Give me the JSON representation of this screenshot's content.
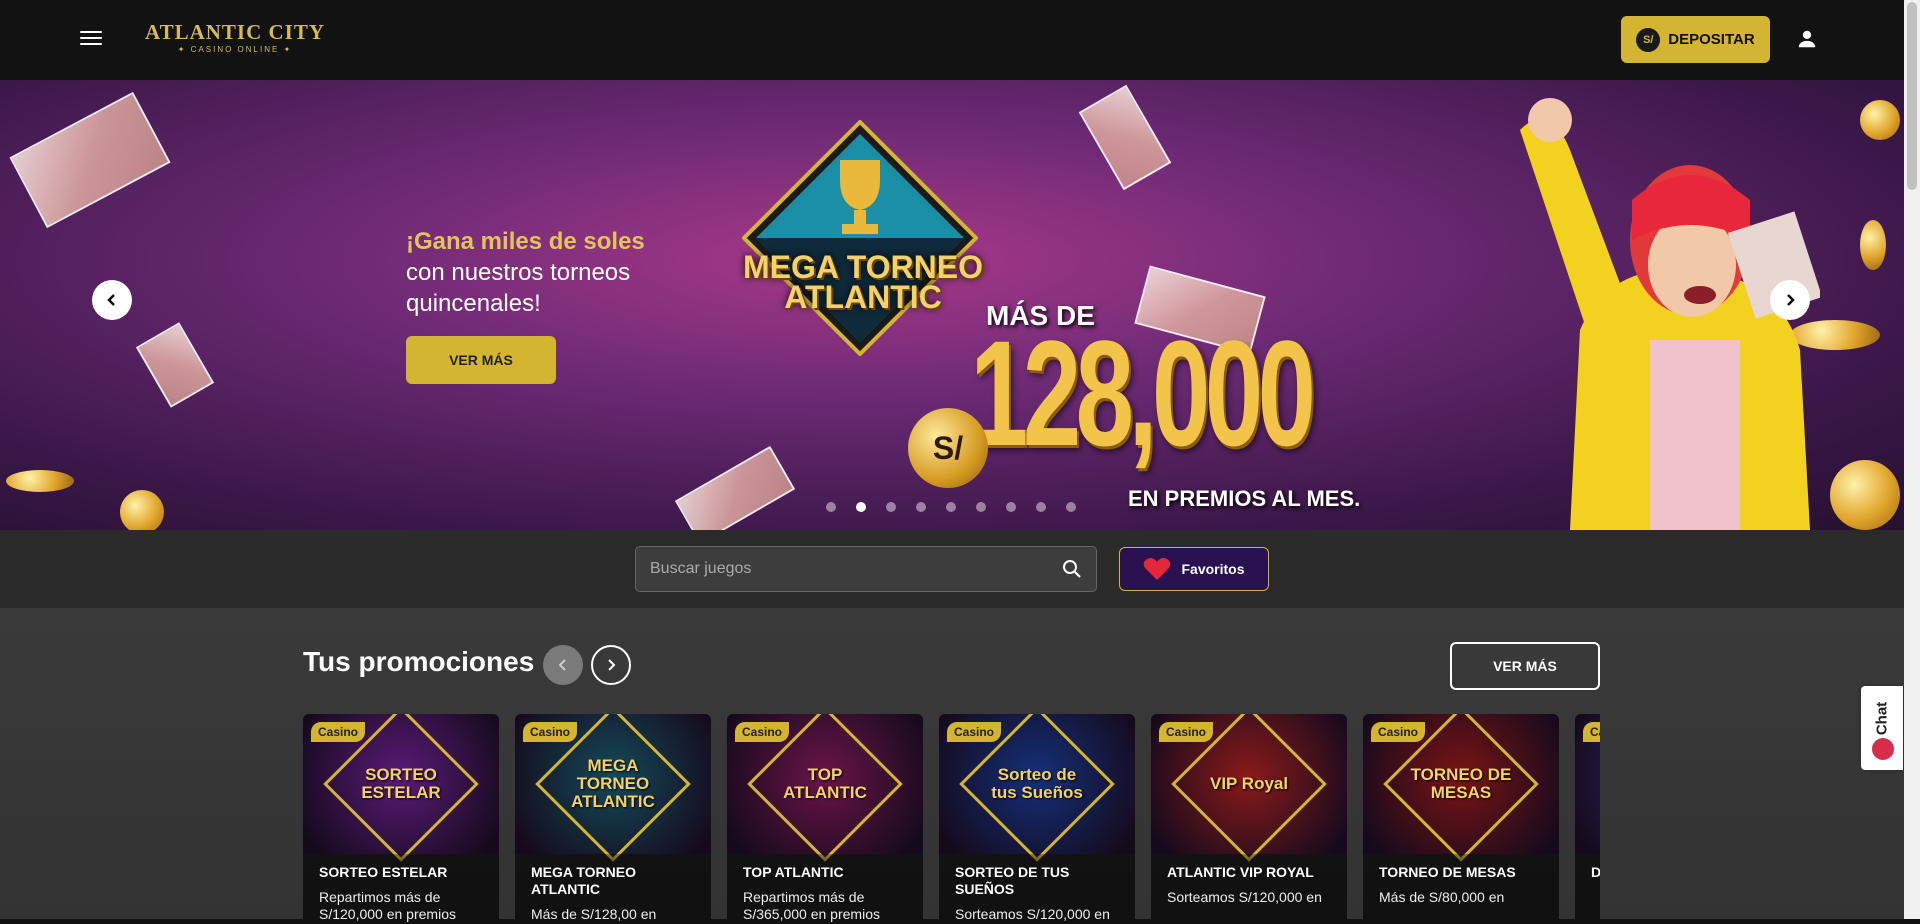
{
  "header": {
    "logo_main": "ATLANTIC CITY",
    "logo_sub": "✦ CASINO ONLINE ✦",
    "deposit_label": "DEPOSITAR",
    "currency_symbol": "S/"
  },
  "hero": {
    "headline_highlight": "¡Gana miles de soles",
    "headline_rest": "con nuestros torneos quincenales!",
    "cta_label": "VER MÁS",
    "banner_title": "MEGA TORNEO ATLANTIC",
    "banner_prefix": "MÁS DE",
    "banner_amount": "128,000",
    "banner_currency": "S/",
    "banner_suffix": "EN PREMIOS AL MES.",
    "slide_count": 9,
    "active_slide": 2
  },
  "search": {
    "placeholder": "Buscar juegos",
    "favorites_label": "Favoritos"
  },
  "promotions": {
    "title": "Tus promociones",
    "ver_mas_label": "VER MÁS",
    "cards": [
      {
        "badge": "Casino",
        "emblem": "SORTEO ESTELAR",
        "title": "SORTEO ESTELAR",
        "desc": "Repartimos más de S/120,000 en premios",
        "bg": "#5a1a78"
      },
      {
        "badge": "Casino",
        "emblem": "MEGA TORNEO ATLANTIC",
        "title": "MEGA TORNEO ATLANTIC",
        "desc": "Más de S/128,00 en",
        "bg": "#144a5a"
      },
      {
        "badge": "Casino",
        "emblem": "TOP ATLANTIC",
        "title": "TOP ATLANTIC",
        "desc": "Repartimos más de S/365,000 en premios",
        "bg": "#6a1448"
      },
      {
        "badge": "Casino",
        "emblem": "Sorteo de tus Sueños",
        "title": "SORTEO DE TUS SUEÑOS",
        "desc": "Sorteamos S/120,000 en",
        "bg": "#14307a"
      },
      {
        "badge": "Casino",
        "emblem": "VIP Royal",
        "title": "ATLANTIC VIP ROYAL",
        "desc": "Sorteamos S/120,000 en",
        "bg": "#8a1a1a"
      },
      {
        "badge": "Casino",
        "emblem": "TORNEO DE MESAS",
        "title": "TORNEO DE MESAS",
        "desc": "Más de S/80,000 en",
        "bg": "#7a1414"
      },
      {
        "badge": "Casino",
        "emblem": "",
        "title": "D",
        "desc": "",
        "bg": "#2a2a6a"
      }
    ]
  },
  "chat": {
    "label": "Chat"
  }
}
